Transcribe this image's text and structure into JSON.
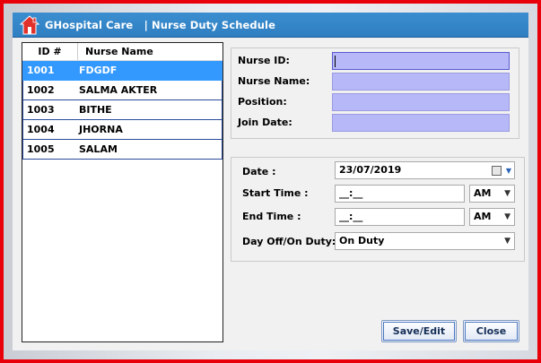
{
  "window": {
    "title": "GHospital Care   | Nurse Duty Schedule",
    "icon": "home-icon"
  },
  "nurse_list": {
    "columns": [
      "ID #",
      "Nurse Name"
    ],
    "rows": [
      {
        "id": "1001",
        "name": "FDGDF"
      },
      {
        "id": "1002",
        "name": "SALMA AKTER"
      },
      {
        "id": "1003",
        "name": "BITHE"
      },
      {
        "id": "1004",
        "name": "JHORNA"
      },
      {
        "id": "1005",
        "name": "SALAM"
      }
    ],
    "selected_index": 0
  },
  "details": {
    "nurse_id_label": "Nurse ID:",
    "nurse_id_value": "",
    "nurse_name_label": "Nurse Name:",
    "nurse_name_value": "",
    "position_label": "Position:",
    "position_value": "",
    "join_date_label": "Join Date:",
    "join_date_value": ""
  },
  "schedule": {
    "date_label": "Date :",
    "date_value": "23/07/2019",
    "start_time_label": "Start Time :",
    "start_time_value": "__:__",
    "start_ampm": "AM",
    "end_time_label": "End Time :",
    "end_time_value": "__:__",
    "end_ampm": "AM",
    "duty_label": "Day Off/On Duty:",
    "duty_value": "On Duty"
  },
  "buttons": {
    "save_label": "Save/Edit",
    "close_label": "Close"
  },
  "colors": {
    "title_bar": "#3a8ecf",
    "frame": "#e8000b",
    "selected_row": "#3399ff",
    "detail_field": "#b7b8f8"
  }
}
